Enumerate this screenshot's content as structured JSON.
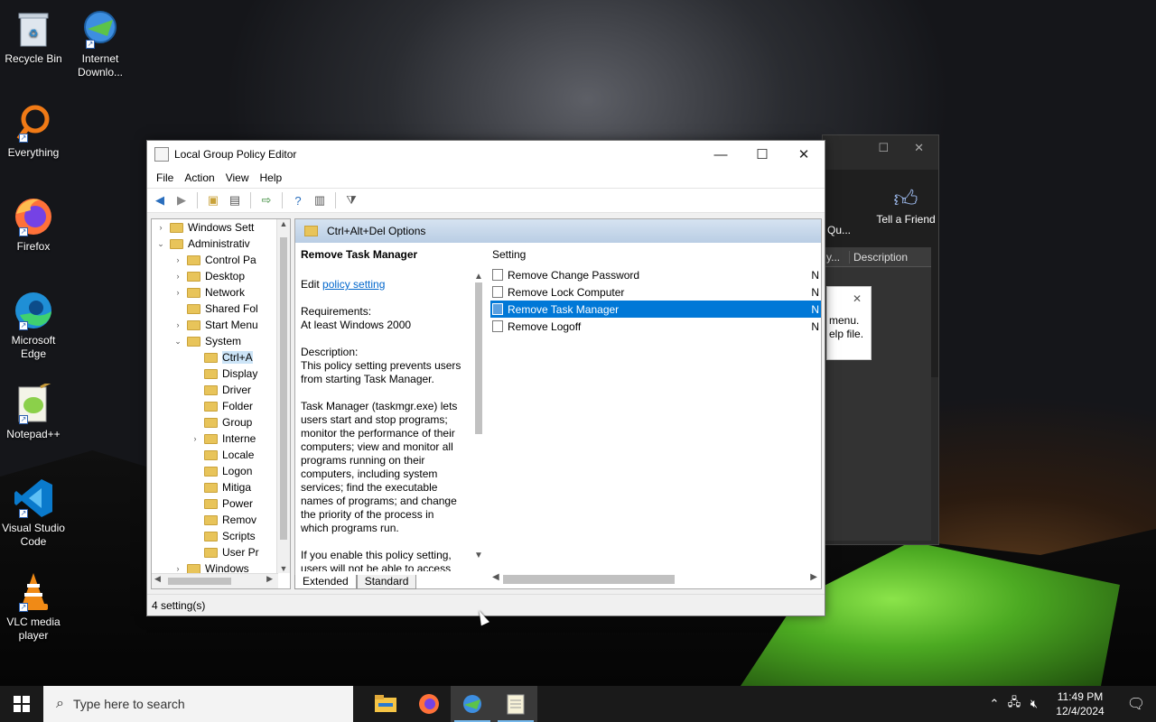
{
  "desktop": {
    "icons": [
      {
        "label": "Recycle Bin",
        "icon": "recycle-bin-icon"
      },
      {
        "label": "Internet Downlo...",
        "icon": "internet-download-manager-icon"
      },
      {
        "label": "Everything",
        "icon": "everything-search-icon"
      },
      {
        "label": "Firefox",
        "icon": "firefox-icon"
      },
      {
        "label": "Microsoft Edge",
        "icon": "edge-icon"
      },
      {
        "label": "Notepad++",
        "icon": "notepadpp-icon"
      },
      {
        "label": "Visual Studio Code",
        "icon": "vscode-icon"
      },
      {
        "label": "VLC media player",
        "icon": "vlc-icon"
      }
    ]
  },
  "background_window": {
    "tell_a_friend": "Tell a Friend",
    "partial_label": "Qu...",
    "column_partial": "y...",
    "column_description": "Description",
    "popup_line1": "menu.",
    "popup_line2": "elp file."
  },
  "window": {
    "title": "Local Group Policy Editor",
    "menu": [
      "File",
      "Action",
      "View",
      "Help"
    ],
    "tree": [
      {
        "label": "Windows Sett",
        "level": 1,
        "exp": "›"
      },
      {
        "label": "Administrativ",
        "level": 1,
        "exp": "⌄"
      },
      {
        "label": "Control Pa",
        "level": 2,
        "exp": "›"
      },
      {
        "label": "Desktop",
        "level": 2,
        "exp": "›"
      },
      {
        "label": "Network",
        "level": 2,
        "exp": "›"
      },
      {
        "label": "Shared Fol",
        "level": 2,
        "exp": ""
      },
      {
        "label": "Start Menu",
        "level": 2,
        "exp": "›"
      },
      {
        "label": "System",
        "level": 2,
        "exp": "⌄"
      },
      {
        "label": "Ctrl+A",
        "level": 3,
        "exp": "",
        "selected": true
      },
      {
        "label": "Display",
        "level": 3,
        "exp": ""
      },
      {
        "label": "Driver",
        "level": 3,
        "exp": ""
      },
      {
        "label": "Folder",
        "level": 3,
        "exp": ""
      },
      {
        "label": "Group",
        "level": 3,
        "exp": ""
      },
      {
        "label": "Interne",
        "level": 3,
        "exp": "›"
      },
      {
        "label": "Locale",
        "level": 3,
        "exp": ""
      },
      {
        "label": "Logon",
        "level": 3,
        "exp": ""
      },
      {
        "label": "Mitiga",
        "level": 3,
        "exp": ""
      },
      {
        "label": "Power",
        "level": 3,
        "exp": ""
      },
      {
        "label": "Remov",
        "level": 3,
        "exp": ""
      },
      {
        "label": "Scripts",
        "level": 3,
        "exp": ""
      },
      {
        "label": "User Pr",
        "level": 3,
        "exp": ""
      },
      {
        "label": "Windows",
        "level": 2,
        "exp": "›"
      }
    ],
    "header_folder": "Ctrl+Alt+Del Options",
    "description": {
      "title": "Remove Task Manager",
      "edit_prefix": "Edit",
      "edit_link": "policy setting",
      "req_label": "Requirements:",
      "req_value": "At least Windows 2000",
      "desc_label": "Description:",
      "desc_p1": "This policy setting prevents users from starting Task Manager.",
      "desc_p2": "Task Manager (taskmgr.exe) lets users start and stop programs; monitor the performance of their computers; view and monitor all programs running on their computers, including system services; find the executable names of programs; and change the priority of the process in which programs run.",
      "desc_p3": "If you enable this policy setting, users will not be able to access"
    },
    "list": {
      "column_setting": "Setting",
      "rows": [
        {
          "name": "Remove Change Password",
          "state": "N"
        },
        {
          "name": "Remove Lock Computer",
          "state": "N"
        },
        {
          "name": "Remove Task Manager",
          "state": "N",
          "selected": true
        },
        {
          "name": "Remove Logoff",
          "state": "N"
        }
      ]
    },
    "tabs": [
      "Extended",
      "Standard"
    ],
    "status": "4 setting(s)"
  },
  "taskbar": {
    "search_placeholder": "Type here to search",
    "apps": [
      "file-explorer-icon",
      "firefox-icon",
      "internet-download-manager-icon",
      "notepad-icon"
    ],
    "time": "11:49 PM",
    "date": "12/4/2024"
  }
}
